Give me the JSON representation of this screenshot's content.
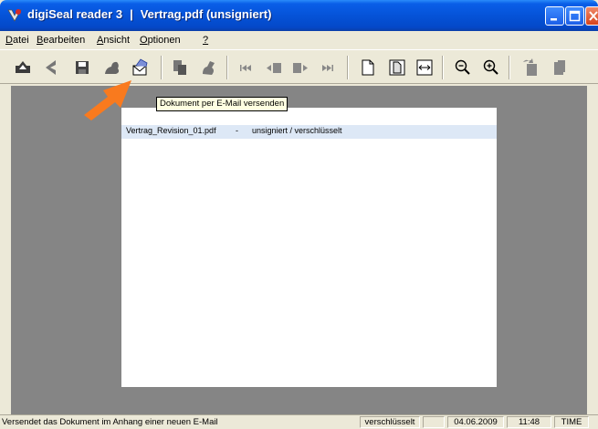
{
  "window": {
    "app_name": "digiSeal reader 3",
    "separator": "|",
    "file_title": "Vertrag.pdf  (unsigniert)"
  },
  "menu": [
    {
      "label": "Datei",
      "mnemonic": "D"
    },
    {
      "label": "Bearbeiten",
      "mnemonic": "B"
    },
    {
      "label": "Ansicht",
      "mnemonic": "A"
    },
    {
      "label": "Optionen",
      "mnemonic": "O"
    },
    {
      "label": "?",
      "mnemonic": "?"
    }
  ],
  "toolbar": {
    "icons": [
      "open-icon",
      "back-icon",
      "save-icon",
      "sign-icon",
      "email-icon",
      "copy-icon",
      "verify-icon",
      "first-page-icon",
      "prev-page-icon",
      "next-page-icon",
      "last-page-icon",
      "page-icon",
      "fit-page-icon",
      "fit-width-icon",
      "zoom-out-icon",
      "zoom-in-icon",
      "rotate-icon",
      "document-icon"
    ]
  },
  "tooltip": "Dokument per E-Mail versenden",
  "document_list": {
    "rows": [
      {
        "filename": "Vertrag_Revision_01.pdf",
        "dash": "-",
        "status": "unsigniert / verschlüsselt"
      }
    ]
  },
  "statusbar": {
    "message": "Versendet das Dokument im Anhang einer neuen E-Mail",
    "encryption": "verschlüsselt",
    "empty_panel": "",
    "date": "04.06.2009",
    "time": "11:48",
    "time_source": "TIME"
  },
  "colors": {
    "titlebar": "#0553d8",
    "workspace": "#858585",
    "selected_row": "#dde8f6",
    "tooltip_bg": "#ffffe1",
    "arrow": "#f97a1e"
  }
}
